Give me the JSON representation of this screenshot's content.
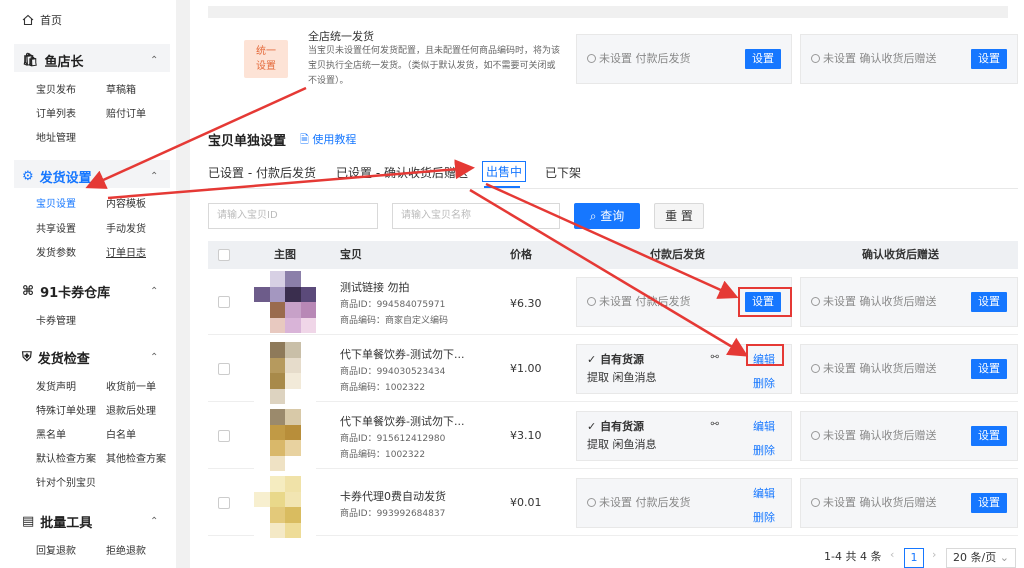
{
  "sidebar": {
    "home": "首页",
    "groups": [
      {
        "title": "鱼店长",
        "items": [
          "宝贝发布",
          "草稿箱",
          "订单列表",
          "赔付订单",
          "地址管理"
        ]
      },
      {
        "title": "发货设置",
        "items": [
          "宝贝设置",
          "内容模板",
          "共享设置",
          "手动发货",
          "发货参数",
          "订单日志"
        ]
      },
      {
        "title": "91卡券仓库",
        "items": [
          "卡券管理"
        ]
      },
      {
        "title": "发货检查",
        "items": [
          "发货声明",
          "收货前一单",
          "特殊订单处理",
          "退款后处理",
          "黑名单",
          "白名单",
          "默认检查方案",
          "其他检查方案",
          "针对个别宝贝"
        ]
      },
      {
        "title": "批量工具",
        "items": [
          "回复退款",
          "拒绝退款"
        ]
      }
    ]
  },
  "unify": {
    "tag": "统一设置",
    "title": "全店统一发货",
    "desc": "当宝贝未设置任何发货配置，且未配置任何商品编码时，将为该宝贝执行全店统一发货。（类似于默认发货，如不需要可关闭或不设置）。",
    "after_pay": "未设置 付款后发货",
    "after_confirm": "未设置 确认收货后赠送",
    "set_label": "设置"
  },
  "section": {
    "title": "宝贝单独设置",
    "tutorial": "使用教程"
  },
  "tabs": [
    "已设置 - 付款后发货",
    "已设置 - 确认收货后赠送",
    "出售中",
    "已下架"
  ],
  "search": {
    "id_placeholder": "请输入宝贝ID",
    "name_placeholder": "请输入宝贝名称",
    "query": "查询",
    "reset": "重 置"
  },
  "table": {
    "headers": [
      "主图",
      "宝贝",
      "价格",
      "付款后发货",
      "确认收货后赠送"
    ],
    "rows": [
      {
        "name": "测试链接 勿拍",
        "id": "商品ID：994584075971",
        "code": "商品编码：商家自定义编码",
        "price": "¥6.30",
        "pay_status": "未设置 付款后发货",
        "pay_action": "设置",
        "confirm": "未设置 确认收货后赠送",
        "confirm_action": "设置"
      },
      {
        "name": "代下单餐饮券-测试勿下...",
        "id": "商品ID：994030523434",
        "code": "商品编码：1002322",
        "price": "¥1.00",
        "pay_status": "自有货源",
        "pay_sub": "提取 闲鱼消息",
        "edit": "编辑",
        "del": "删除",
        "confirm": "未设置 确认收货后赠送",
        "confirm_action": "设置"
      },
      {
        "name": "代下单餐饮券-测试勿下...",
        "id": "商品ID：915612412980",
        "code": "商品编码：1002322",
        "price": "¥3.10",
        "pay_status": "自有货源",
        "pay_sub": "提取 闲鱼消息",
        "edit": "编辑",
        "del": "删除",
        "confirm": "未设置 确认收货后赠送",
        "confirm_action": "设置"
      },
      {
        "name": "卡券代理0费自动发货",
        "id": "商品ID：993992684837",
        "code": "",
        "price": "¥0.01",
        "pay_status": "未设置 付款后发货",
        "edit": "编辑",
        "del": "删除",
        "confirm": "未设置 确认收货后赠送",
        "confirm_action": "设置"
      }
    ]
  },
  "pager": {
    "summary": "1-4 共 4 条",
    "page": "1",
    "size": "20 条/页"
  },
  "colors": {
    "primary": "#1677ff",
    "annotation": "#e53935",
    "tag_bg": "#fde3d6",
    "tag_fg": "#e4693a"
  }
}
